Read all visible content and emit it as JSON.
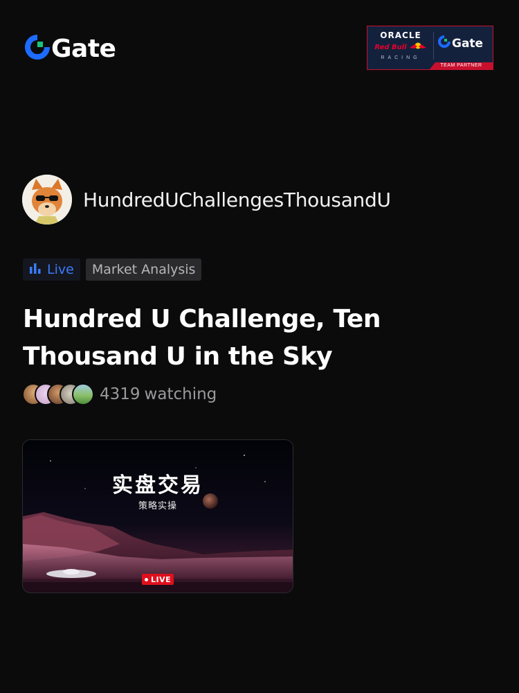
{
  "brand": {
    "name": "Gate",
    "accent": "#1d6bff",
    "green": "#19c37d"
  },
  "partner": {
    "oracle": "ORACLE",
    "redbull": "Red Bull",
    "racing": "RACING",
    "gate": "Gate",
    "team_label": "TEAM PARTNER",
    "background": "#14213d",
    "accent": "#c8102e"
  },
  "host": {
    "name": "HundredUChallengesThousandU"
  },
  "tags": {
    "live": "Live",
    "category": "Market Analysis"
  },
  "stream": {
    "title": "Hundred U Challenge, Ten Thousand U in the Sky"
  },
  "watchers": {
    "count": "4319",
    "label": "watching"
  },
  "card": {
    "title": "实盘交易",
    "subtitle": "策略实操",
    "live_label": "LIVE"
  }
}
